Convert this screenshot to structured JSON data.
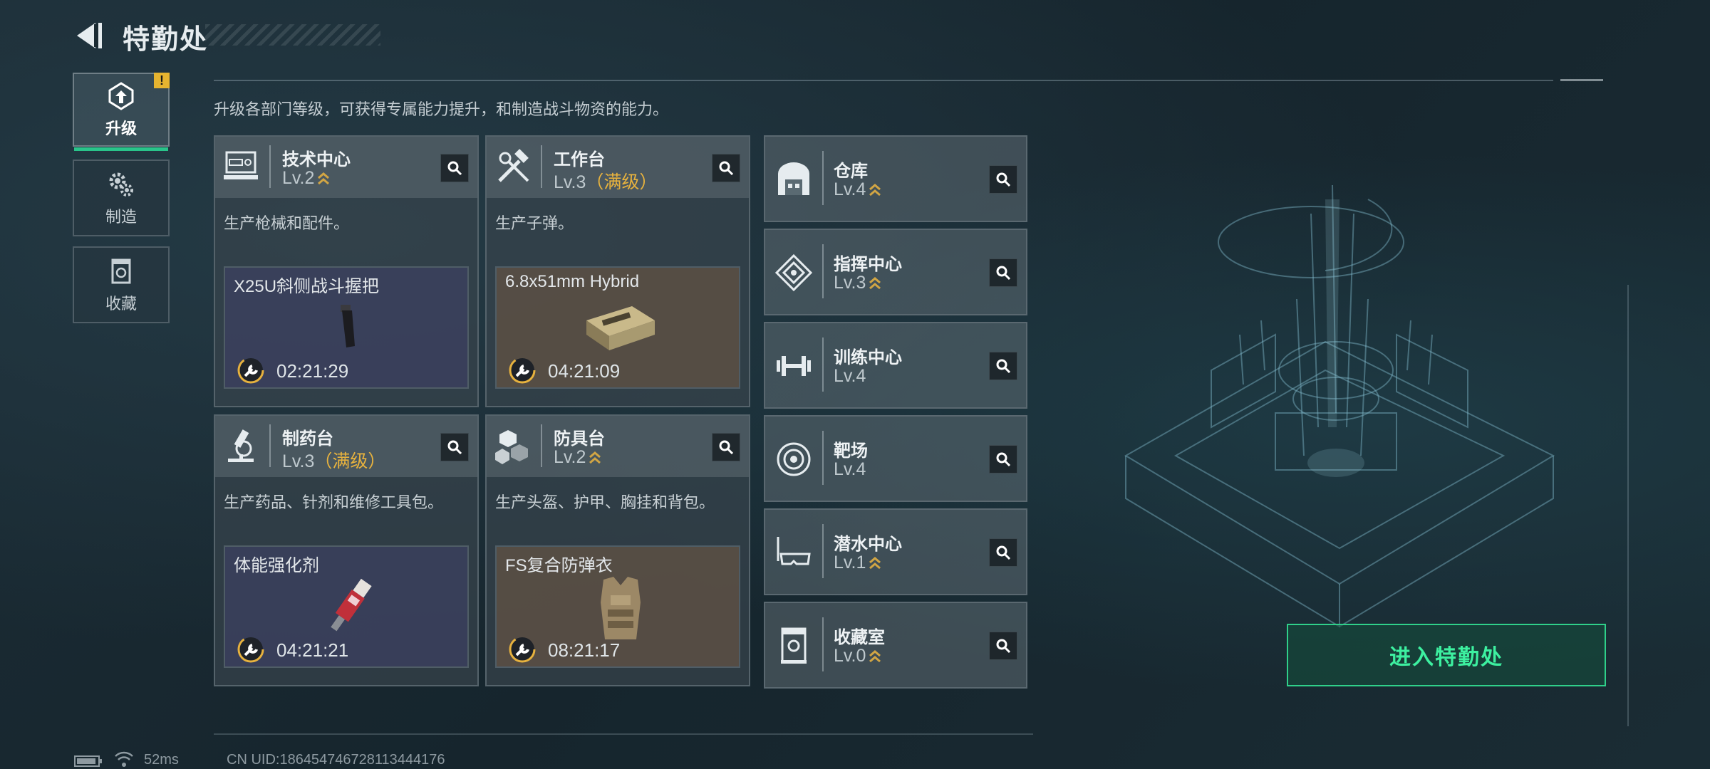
{
  "header": {
    "title": "特勤处"
  },
  "tabs": [
    {
      "label": "升级",
      "active": true,
      "warning": "!"
    },
    {
      "label": "制造",
      "active": false
    },
    {
      "label": "收藏",
      "active": false
    }
  ],
  "description": "升级各部门等级，可获得专属能力提升，和制造战斗物资的能力。",
  "workshops": [
    {
      "name": "技术中心",
      "level": "Lv.2",
      "maxed": "",
      "desc": "生产枪械和配件。",
      "item": "X25U斜侧战斗握把",
      "time": "02:21:29"
    },
    {
      "name": "工作台",
      "level": "Lv.3",
      "maxed": "（满级）",
      "desc": "生产子弹。",
      "item": "6.8x51mm Hybrid",
      "time": "04:21:09"
    },
    {
      "name": "制药台",
      "level": "Lv.3",
      "maxed": "（满级）",
      "desc": "生产药品、针剂和维修工具包。",
      "item": "体能强化剂",
      "time": "04:21:21"
    },
    {
      "name": "防具台",
      "level": "Lv.2",
      "maxed": "",
      "desc": "生产头盔、护甲、胸挂和背包。",
      "item": "FS复合防弹衣",
      "time": "08:21:17"
    }
  ],
  "departments": [
    {
      "name": "仓库",
      "level": "Lv.4"
    },
    {
      "name": "指挥中心",
      "level": "Lv.3"
    },
    {
      "name": "训练中心",
      "level": "Lv.4"
    },
    {
      "name": "靶场",
      "level": "Lv.4"
    },
    {
      "name": "潜水中心",
      "level": "Lv.1"
    },
    {
      "name": "收藏室",
      "level": "Lv.0"
    }
  ],
  "enter_button": "进入特勤处",
  "status": {
    "ping": "52ms",
    "uid": "CN UID:1864547467281134441​76"
  },
  "colors": {
    "accent_green": "#2fd08a",
    "maxed_gold": "#e7b23e",
    "warning": "#e6b430"
  }
}
